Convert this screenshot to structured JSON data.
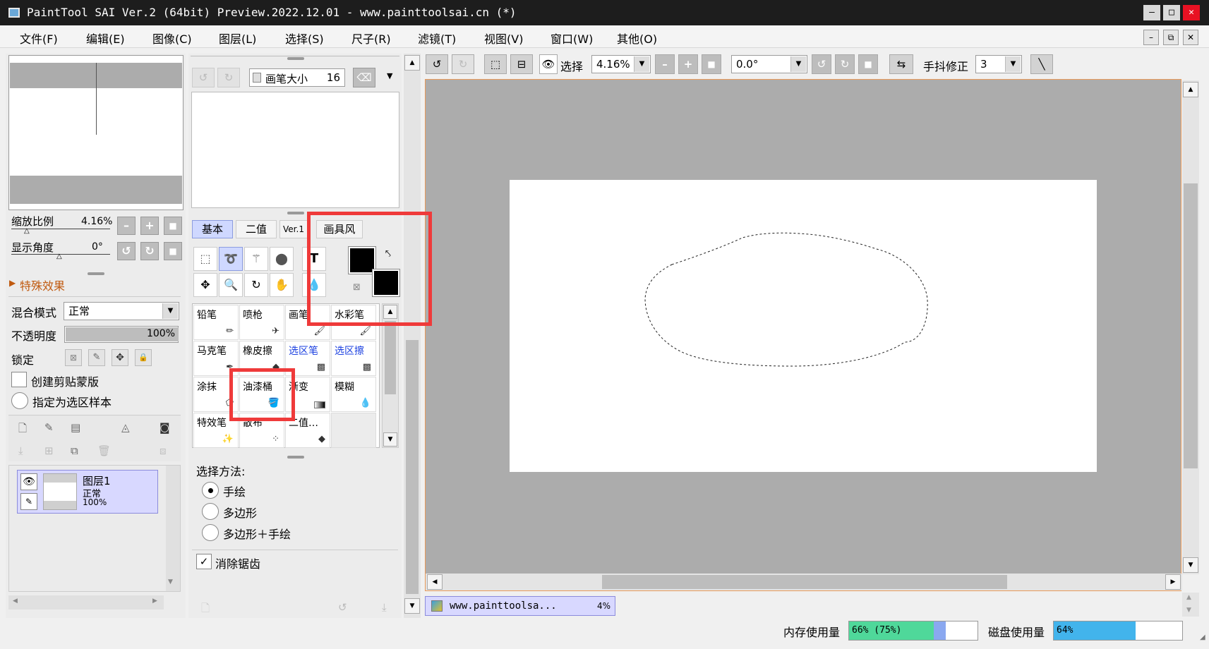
{
  "window": {
    "title": "PaintTool SAI Ver.2 (64bit) Preview.2022.12.01 - www.painttoolsai.cn (*)",
    "minimize": "–",
    "maximize": "□",
    "close": "✕"
  },
  "menu": [
    "文件(F)",
    "编辑(E)",
    "图像(C)",
    "图层(L)",
    "选择(S)",
    "尺子(R)",
    "滤镜(T)",
    "视图(V)",
    "窗口(W)",
    "其他(O)"
  ],
  "navigator": {
    "zoom_label": "缩放比例",
    "zoom_value": "4.16%",
    "angle_label": "显示角度",
    "angle_value": "0°"
  },
  "layer_panel": {
    "effects": "特殊效果",
    "blend_label": "混合模式",
    "blend_value": "正常",
    "opacity_label": "不透明度",
    "opacity_value": "100%",
    "opacity_percent": 100,
    "lock_label": "锁定",
    "clip_label": "创建剪贴蒙版",
    "sample_label": "指定为选区样本",
    "layer_name": "图层1",
    "layer_mode": "正常",
    "layer_opacity": "100%"
  },
  "brush_panel": {
    "size_label": "画笔大小",
    "size_value": "16"
  },
  "tabs": [
    "基本",
    "二值",
    "Ver.1",
    "画具风"
  ],
  "tools": [
    {
      "label": "铅笔",
      "color": "normal"
    },
    {
      "label": "喷枪",
      "color": "normal"
    },
    {
      "label": "画笔",
      "color": "normal"
    },
    {
      "label": "水彩笔",
      "color": "normal"
    },
    {
      "label": "马克笔",
      "color": "normal"
    },
    {
      "label": "橡皮擦",
      "color": "normal"
    },
    {
      "label": "选区笔",
      "color": "blue"
    },
    {
      "label": "选区擦",
      "color": "blue"
    },
    {
      "label": "涂抹",
      "color": "normal"
    },
    {
      "label": "油漆桶",
      "color": "normal"
    },
    {
      "label": "渐变",
      "color": "normal"
    },
    {
      "label": "模糊",
      "color": "normal"
    },
    {
      "label": "特效笔",
      "color": "normal"
    },
    {
      "label": "散布",
      "color": "normal"
    },
    {
      "label": "二值…",
      "color": "normal"
    }
  ],
  "selection": {
    "method_label": "选择方法:",
    "options": [
      "手绘",
      "多边形",
      "多边形＋手绘"
    ],
    "antialias_label": "消除锯齿"
  },
  "toolbar": {
    "select_label": "选择",
    "zoom_value": "4.16%",
    "angle_value": "0.0°",
    "stabilizer_label": "手抖修正",
    "stabilizer_value": "3"
  },
  "doc_tab": {
    "name": "www.painttoolsa...",
    "zoom": "4%"
  },
  "status": {
    "mem_label": "内存使用量",
    "mem_value": "66% (75%)",
    "mem_percent": 66,
    "disk_label": "磁盘使用量",
    "disk_value": "64%",
    "disk_percent": 64
  },
  "colors": {
    "fg": "#000000",
    "bg": "#000000",
    "highlight": "#ef3a3a",
    "canvas_bg": "#acacac"
  }
}
